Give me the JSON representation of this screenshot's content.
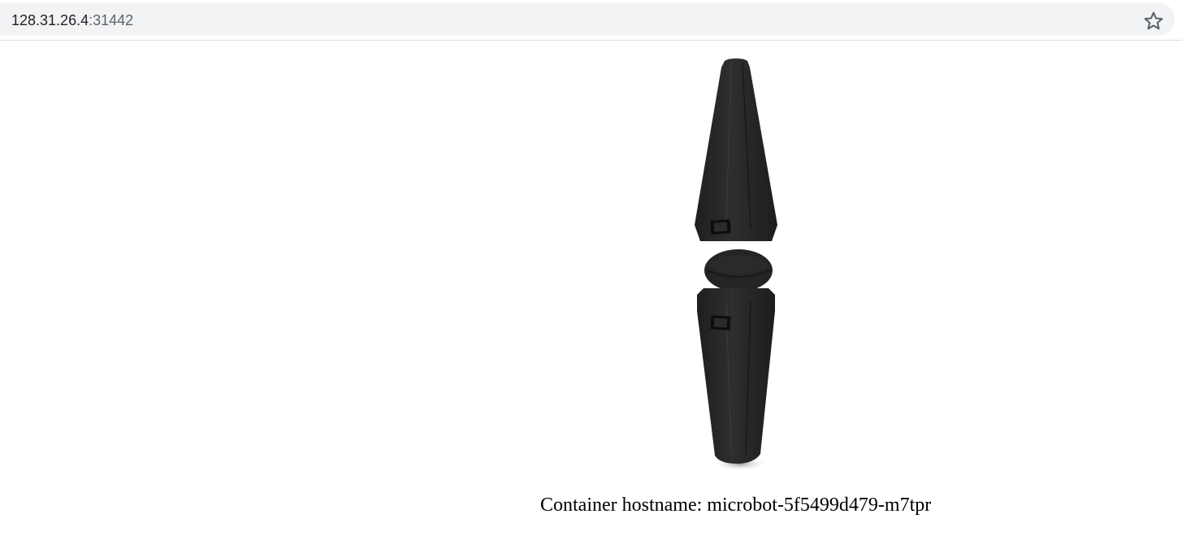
{
  "browser": {
    "address": {
      "host": "128.31.26.4",
      "port": ":31442"
    },
    "bookmark_icon": "star-outline-icon"
  },
  "page": {
    "image_subject": "microbot-figure",
    "hostname_label": "Container hostname: microbot-5f5499d479-m7tpr"
  },
  "colors": {
    "omnibox_bg": "#f1f3f4",
    "url_host": "#202124",
    "url_port": "#5f6368",
    "robot_body": "#262626"
  }
}
